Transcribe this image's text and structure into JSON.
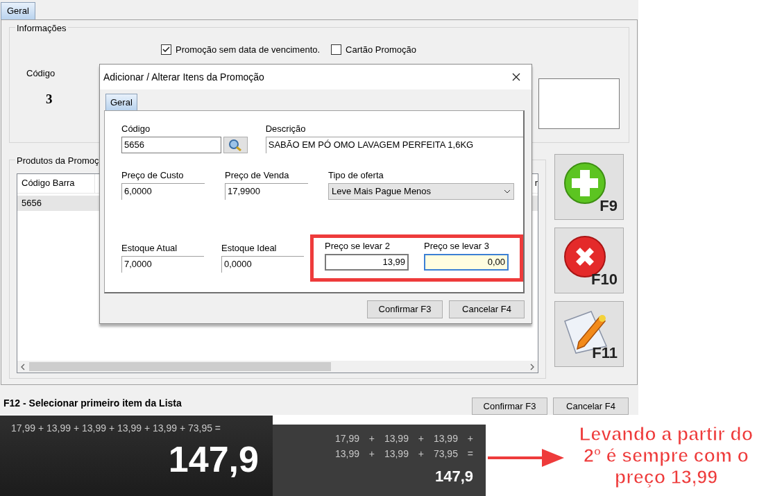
{
  "main_window": {
    "tab": {
      "label": "Geral",
      "selected": true
    },
    "info_group": {
      "title": "Informações",
      "checkboxes": [
        {
          "label": "Promoção sem data de vencimento.",
          "checked": true
        },
        {
          "label": "Cartão Promoção",
          "checked": false
        }
      ],
      "code_label": "Código",
      "code_value": "3"
    },
    "products_group": {
      "title": "Produtos da Promoç",
      "columns": [
        "Código Barra"
      ],
      "rows": [
        {
          "cells": [
            "5656"
          ],
          "selected": true
        }
      ],
      "column_2_fragment": "r"
    },
    "side_buttons": [
      {
        "kind": "add",
        "key": "F9"
      },
      {
        "kind": "remove",
        "key": "F10"
      },
      {
        "kind": "edit",
        "key": "F11"
      }
    ],
    "footer_hint": "F12 - Selecionar primeiro item da Lista",
    "buttons": [
      "Confirmar F3",
      "Cancelar F4"
    ]
  },
  "dialog": {
    "title": "Adicionar / Alterar Itens da Promoção",
    "tab": {
      "label": "Geral",
      "selected": true
    },
    "rows": [
      [
        {
          "kind": "lookup",
          "label": "Código",
          "value": "5656"
        },
        {
          "kind": "text",
          "label": "Descrição",
          "value": "SABÃO EM PÓ OMO LAVAGEM PERFEITA 1,6KG"
        }
      ],
      [
        {
          "kind": "text",
          "label": "Preço de Custo",
          "value": "6,0000"
        },
        {
          "kind": "text",
          "label": "Preço de Venda",
          "value": "17,9900"
        },
        {
          "kind": "select",
          "label": "Tipo de oferta",
          "value": "Leve Mais Pague Menos"
        }
      ],
      [
        {
          "kind": "text",
          "label": "Estoque Atual",
          "value": "7,0000"
        },
        {
          "kind": "text",
          "label": "Estoque Ideal",
          "value": "0,0000"
        }
      ]
    ],
    "highlighted_fields": [
      {
        "kind": "number",
        "label": "Preço se levar 2",
        "value": "13,99",
        "focused": false
      },
      {
        "kind": "number",
        "label": "Preço se levar 3",
        "value": "0,00",
        "focused": true
      }
    ],
    "buttons": [
      "Confirmar F3",
      "Cancelar F4"
    ]
  },
  "calculator_left": {
    "expression": "17,99 + 13,99 + 13,99 + 13,99 + 13,99 + 73,95 =",
    "result": "147,9"
  },
  "calculator_right": {
    "expression_lines": [
      "17,99 + 13,99 + 13,99 +",
      "13,99 + 13,99 + 73,95 ="
    ],
    "result": "147,9"
  },
  "annotation": {
    "lines": [
      "Levando a partir do",
      "2º é sempre com o",
      "preço 13,99"
    ]
  }
}
